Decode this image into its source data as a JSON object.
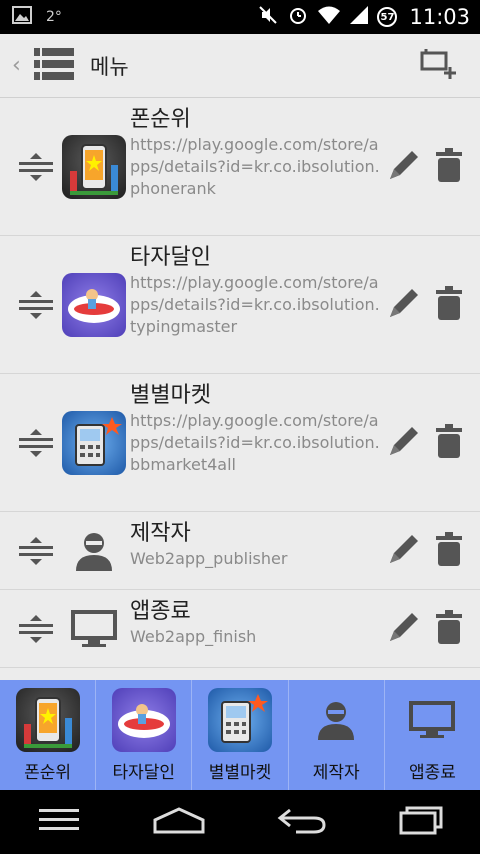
{
  "status_bar": {
    "temperature": "2°",
    "time": "11:03",
    "battery_level": "57"
  },
  "action_bar": {
    "title": "메뉴"
  },
  "items": [
    {
      "name": "폰순위",
      "url": "https://play.google.com/store/apps/details?id=kr.co.ibsolution.phonerank",
      "icon": "phonerank-app-icon"
    },
    {
      "name": "타자달인",
      "url": "https://play.google.com/store/apps/details?id=kr.co.ibsolution.typingmaster",
      "icon": "typingmaster-app-icon"
    },
    {
      "name": "별별마켓",
      "url": "https://play.google.com/store/apps/details?id=kr.co.ibsolution.bbmarket4all",
      "icon": "bbmarket-app-icon"
    },
    {
      "name": "제작자",
      "url": "Web2app_publisher",
      "icon": "person-icon"
    },
    {
      "name": "앱종료",
      "url": "Web2app_finish",
      "icon": "monitor-icon"
    }
  ],
  "tabs": [
    {
      "label": "폰순위"
    },
    {
      "label": "타자달인"
    },
    {
      "label": "별별마켓"
    },
    {
      "label": "제작자"
    },
    {
      "label": "앱종료"
    }
  ],
  "colors": {
    "tab_bar": "#7495f2",
    "background": "#ececec",
    "icon_gray": "#555555"
  }
}
